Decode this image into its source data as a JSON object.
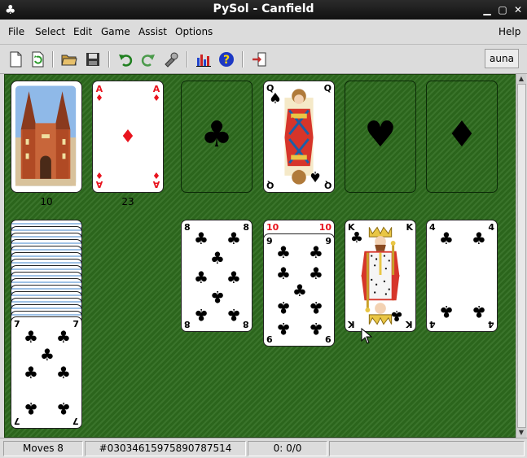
{
  "window": {
    "title": "PySol - Canfield"
  },
  "menu": [
    "File",
    "Select",
    "Edit",
    "Game",
    "Assist",
    "Options"
  ],
  "help": "Help",
  "player": "auna",
  "counts": {
    "talon": "10",
    "waste": "23"
  },
  "foundations": {
    "1": {
      "rank": "Q",
      "suit": "♠"
    }
  },
  "reserve": {
    "rank": "7",
    "suit": "♣"
  },
  "tableau": {
    "t1": {
      "rank": "8",
      "suit": "♣"
    },
    "t2_under": {
      "rank": "10"
    },
    "t2": {
      "rank": "9",
      "suit": "♣"
    },
    "t3": {
      "rank": "K",
      "suit": "♣"
    },
    "t4": {
      "rank": "4",
      "suit": "♣"
    }
  },
  "waste_card": {
    "rank": "A",
    "suit": "♦"
  },
  "slots": {
    "f0": "♣",
    "f2": "♥",
    "f3": "♦"
  },
  "status": {
    "moves": "Moves 8",
    "seed": "#03034615975890787514",
    "time": "0: 0/0"
  },
  "colors": {
    "felt": "#2e6b1e",
    "red": "#e8141e"
  },
  "icons": [
    "new-game-icon",
    "restart-icon",
    "open-icon",
    "save-icon",
    "undo-icon",
    "redo-icon",
    "autodrop-icon",
    "statistics-icon",
    "help-icon",
    "quit-icon"
  ]
}
